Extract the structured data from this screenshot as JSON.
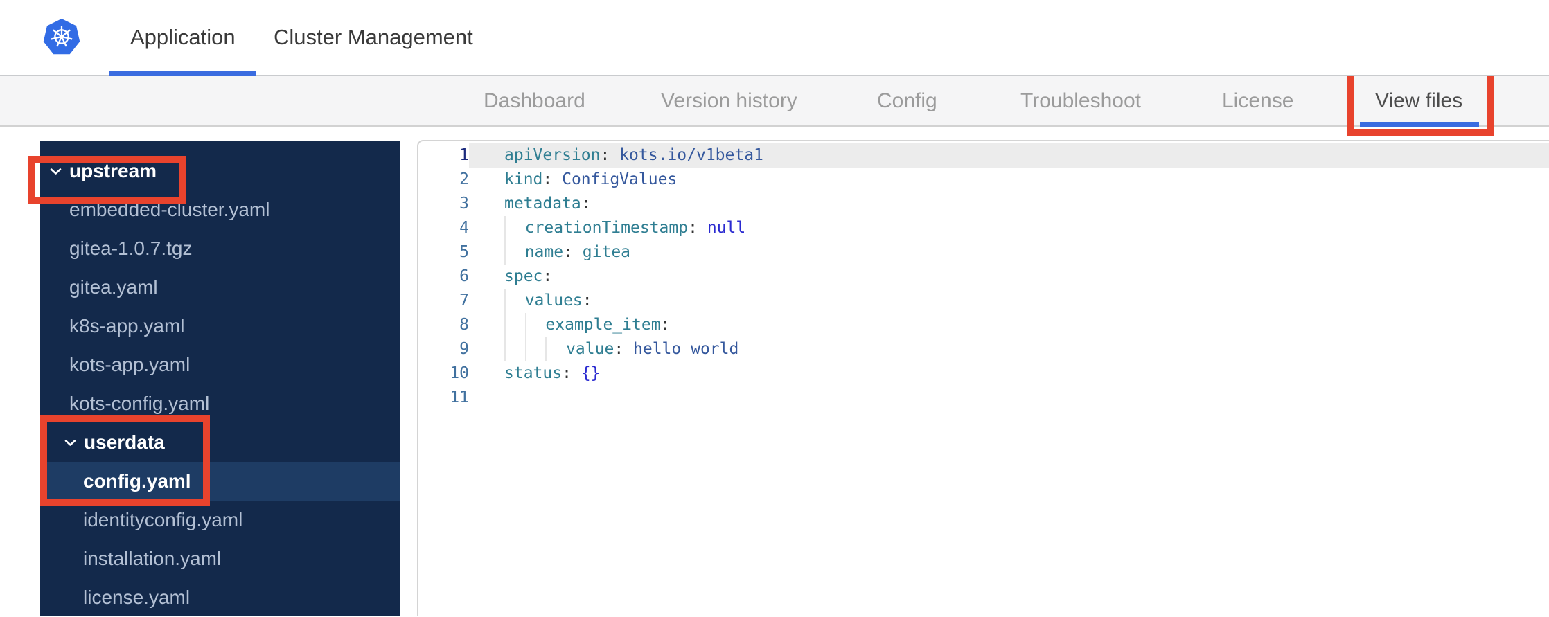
{
  "header": {
    "tabs": [
      {
        "label": "Application",
        "active": true
      },
      {
        "label": "Cluster Management",
        "active": false
      }
    ]
  },
  "nav": {
    "tabs": [
      {
        "label": "Dashboard",
        "active": false
      },
      {
        "label": "Version history",
        "active": false
      },
      {
        "label": "Config",
        "active": false
      },
      {
        "label": "Troubleshoot",
        "active": false
      },
      {
        "label": "License",
        "active": false
      },
      {
        "label": "View files",
        "active": true,
        "annotated": true
      }
    ]
  },
  "sidebar": {
    "items": [
      {
        "label": "upstream",
        "type": "folder",
        "level": 0,
        "expanded": true,
        "annotated": true
      },
      {
        "label": "embedded-cluster.yaml",
        "type": "file",
        "level": 1
      },
      {
        "label": "gitea-1.0.7.tgz",
        "type": "file",
        "level": 1
      },
      {
        "label": "gitea.yaml",
        "type": "file",
        "level": 1
      },
      {
        "label": "k8s-app.yaml",
        "type": "file",
        "level": 1
      },
      {
        "label": "kots-app.yaml",
        "type": "file",
        "level": 1
      },
      {
        "label": "kots-config.yaml",
        "type": "file",
        "level": 1
      },
      {
        "label": "userdata",
        "type": "folder",
        "level": 1,
        "expanded": true,
        "annotated": true
      },
      {
        "label": "config.yaml",
        "type": "file",
        "level": 2,
        "selected": true,
        "annotated": true
      },
      {
        "label": "identityconfig.yaml",
        "type": "file",
        "level": 2
      },
      {
        "label": "installation.yaml",
        "type": "file",
        "level": 2
      },
      {
        "label": "license.yaml",
        "type": "file",
        "level": 2
      }
    ]
  },
  "editor": {
    "language": "yaml",
    "lines": [
      {
        "n": "1",
        "active": true,
        "guides": 0,
        "tokens": [
          {
            "t": "apiVersion",
            "c": "key"
          },
          {
            "t": ":",
            "c": "punct"
          },
          {
            "t": " kots.io/v1beta1",
            "c": "val"
          }
        ]
      },
      {
        "n": "2",
        "guides": 0,
        "tokens": [
          {
            "t": "kind",
            "c": "key"
          },
          {
            "t": ":",
            "c": "punct"
          },
          {
            "t": " ConfigValues",
            "c": "val"
          }
        ]
      },
      {
        "n": "3",
        "guides": 0,
        "tokens": [
          {
            "t": "metadata",
            "c": "key"
          },
          {
            "t": ":",
            "c": "punct"
          }
        ]
      },
      {
        "n": "4",
        "guides": 1,
        "tokens": [
          {
            "t": "creationTimestamp",
            "c": "key"
          },
          {
            "t": ":",
            "c": "punct"
          },
          {
            "t": " ",
            "c": "punct"
          },
          {
            "t": "null",
            "c": "kw"
          }
        ]
      },
      {
        "n": "5",
        "guides": 1,
        "tokens": [
          {
            "t": "name",
            "c": "key"
          },
          {
            "t": ":",
            "c": "punct"
          },
          {
            "t": " gitea",
            "c": "key"
          }
        ]
      },
      {
        "n": "6",
        "guides": 0,
        "tokens": [
          {
            "t": "spec",
            "c": "key"
          },
          {
            "t": ":",
            "c": "punct"
          }
        ]
      },
      {
        "n": "7",
        "guides": 1,
        "tokens": [
          {
            "t": "values",
            "c": "key"
          },
          {
            "t": ":",
            "c": "punct"
          }
        ]
      },
      {
        "n": "8",
        "guides": 2,
        "tokens": [
          {
            "t": "example_item",
            "c": "key"
          },
          {
            "t": ":",
            "c": "punct"
          }
        ]
      },
      {
        "n": "9",
        "guides": 3,
        "tokens": [
          {
            "t": "value",
            "c": "key"
          },
          {
            "t": ":",
            "c": "punct"
          },
          {
            "t": " hello world",
            "c": "val"
          }
        ]
      },
      {
        "n": "10",
        "guides": 0,
        "tokens": [
          {
            "t": "status",
            "c": "key"
          },
          {
            "t": ":",
            "c": "punct"
          },
          {
            "t": " ",
            "c": "punct"
          },
          {
            "t": "{}",
            "c": "kw"
          }
        ]
      },
      {
        "n": "11",
        "guides": 0,
        "tokens": []
      }
    ]
  },
  "annotations": [
    {
      "target": "view-files-tab"
    },
    {
      "target": "upstream-folder"
    },
    {
      "target": "userdata-and-config-yaml"
    }
  ],
  "colors": {
    "brand_blue": "#326ce5",
    "active_tab_underline": "#3a6ce0",
    "annotation_red": "#e8432d",
    "sidebar_bg": "#13294b",
    "sidebar_selected_bg": "#1e3c64",
    "code_key": "#2f7e92",
    "code_value": "#35589d",
    "code_keyword": "#2a2ad0",
    "active_line_highlight": "#ececec"
  }
}
